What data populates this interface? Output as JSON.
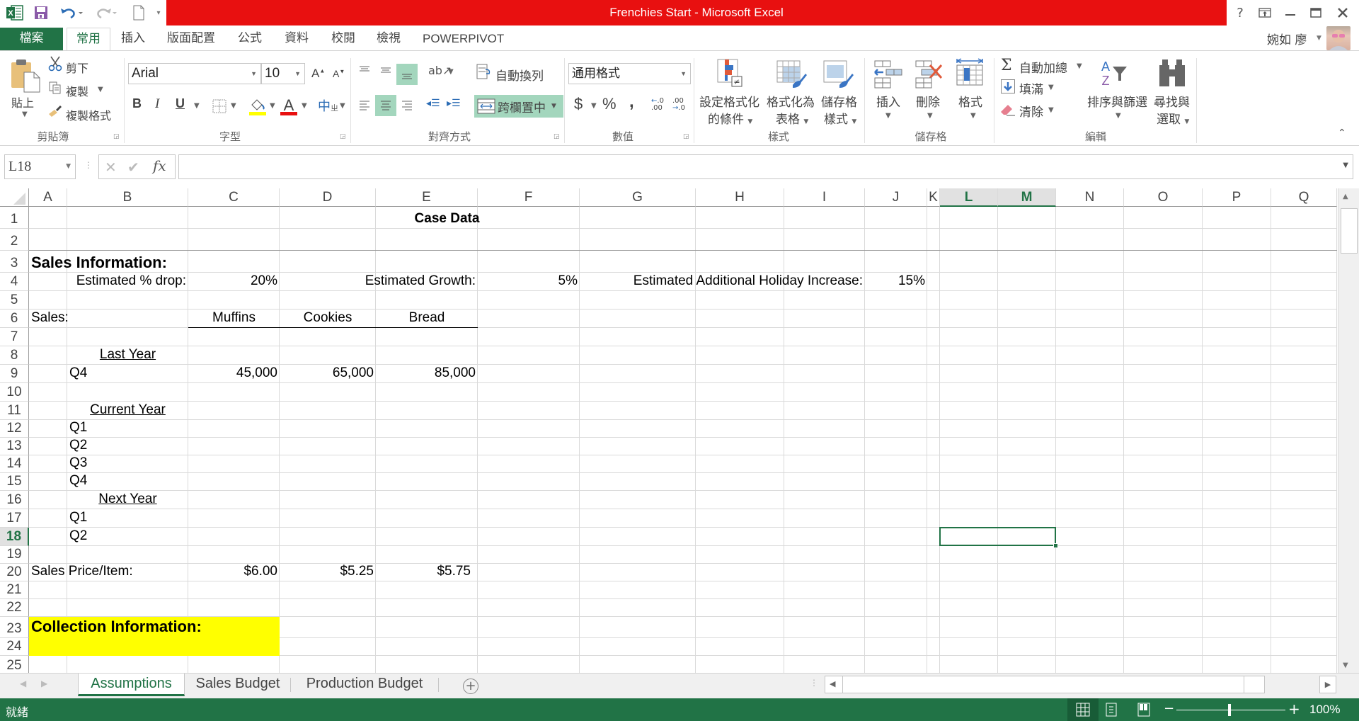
{
  "window": {
    "title": "Frenchies Start -  Microsoft Excel",
    "buttons": {
      "help": "?",
      "ribbon_display": "⇱",
      "minimize": "—",
      "maximize": "☐",
      "close": "✕"
    },
    "user_name": "婉如 廖",
    "accent_color": "#217346",
    "title_color": "#e81010"
  },
  "quick_access": {
    "save": "save",
    "undo": "undo",
    "redo": "redo",
    "new": "new-document",
    "customize": "▾"
  },
  "ribbon_tabs": [
    {
      "label": "檔案"
    },
    {
      "label": "常用"
    },
    {
      "label": "插入"
    },
    {
      "label": "版面配置"
    },
    {
      "label": "公式"
    },
    {
      "label": "資料"
    },
    {
      "label": "校閱"
    },
    {
      "label": "檢視"
    },
    {
      "label": "POWERPIVOT"
    }
  ],
  "ribbon": {
    "clipboard": {
      "label": "剪貼簿",
      "paste": "貼上",
      "cut": "剪下",
      "copy": "複製",
      "format_painter": "複製格式"
    },
    "font": {
      "label": "字型",
      "font_name": "Arial",
      "font_size": "10",
      "bold": "B",
      "italic": "I",
      "underline": "U",
      "grow": "A",
      "shrink": "A",
      "phonetic": "中"
    },
    "alignment": {
      "label": "對齊方式",
      "wrap_text": "自動換列",
      "merge_center": "跨欄置中"
    },
    "number": {
      "label": "數值",
      "format": "通用格式",
      "currency": "$",
      "percent": "%",
      "comma": ","
    },
    "styles": {
      "label": "樣式",
      "conditional_1": "設定格式化",
      "conditional_2": "的條件",
      "table_1": "格式化為",
      "table_2": "表格",
      "cell_styles_1": "儲存格",
      "cell_styles_2": "樣式"
    },
    "cells": {
      "label": "儲存格",
      "insert": "插入",
      "delete": "刪除",
      "format": "格式"
    },
    "editing": {
      "label": "編輯",
      "autosum": "自動加總",
      "fill": "填滿",
      "clear": "清除",
      "sort_filter": "排序與篩選",
      "find_1": "尋找與",
      "find_2": "選取"
    }
  },
  "formula_bar": {
    "name_box": "L18",
    "formula": ""
  },
  "columns": [
    "A",
    "B",
    "C",
    "D",
    "E",
    "F",
    "G",
    "H",
    "I",
    "J",
    "K",
    "L",
    "M",
    "N",
    "O",
    "P",
    "Q"
  ],
  "rows": [
    "1",
    "2",
    "3",
    "4",
    "5",
    "6",
    "7",
    "8",
    "9",
    "10",
    "11",
    "12",
    "13",
    "14",
    "15",
    "16",
    "17",
    "18",
    "19",
    "20",
    "21",
    "22",
    "23",
    "24",
    "25"
  ],
  "selected_cell": "L18",
  "cells": {
    "title": "Case Data",
    "sales_info": "Sales Information:",
    "est_drop_label": "Estimated % drop:",
    "est_drop_value": "20%",
    "est_growth_label": "Estimated Growth:",
    "est_growth_value": "5%",
    "holiday_label": "Estimated Additional Holiday Increase:",
    "holiday_value": "15%",
    "sales_label": "Sales:",
    "muffins": "Muffins",
    "cookies": "Cookies",
    "bread": "Bread",
    "last_year": "Last Year",
    "ly_q4": "Q4",
    "ly_q4_muffins": "45,000",
    "ly_q4_cookies": "65,000",
    "ly_q4_bread": "85,000",
    "current_year": "Current Year",
    "cy_q1": "Q1",
    "cy_q2": "Q2",
    "cy_q3": "Q3",
    "cy_q4": "Q4",
    "next_year": "Next Year",
    "ny_q1": "Q1",
    "ny_q2": "Q2",
    "price_label": "Sales Price/Item:",
    "price_muffins": "$6.00",
    "price_cookies": "$5.25",
    "price_bread": "$5.75",
    "collection_info": "Collection Information:",
    "collection_fill": "#ffff00"
  },
  "sheet_tabs": [
    {
      "label": "Assumptions",
      "active": true
    },
    {
      "label": "Sales Budget",
      "active": false
    },
    {
      "label": "Production Budget",
      "active": false
    }
  ],
  "status_bar": {
    "status": "就緒",
    "zoom": "100%",
    "zoom_minus": "−",
    "zoom_plus": "+"
  }
}
